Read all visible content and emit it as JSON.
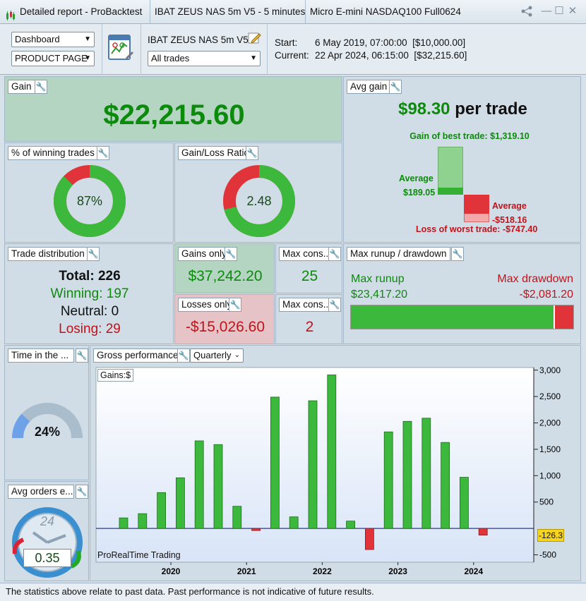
{
  "window": {
    "app_title": "Detailed report - ProBacktest",
    "strategy_title": "IBAT ZEUS NAS 5m V5 - 5 minutes",
    "instrument_title": "Micro E-mini NASDAQ100 Full0624"
  },
  "toolbar": {
    "view_select": "Dashboard",
    "page_select": "PRODUCT PAGE",
    "strategy_name": "IBAT ZEUS NAS 5m V5",
    "trades_filter": "All trades",
    "start_label": "Start:",
    "start_value": "6 May 2019, 07:00:00  [$10,000.00]",
    "current_label": "Current:",
    "current_value": "22 Apr 2024, 06:15:00  [$32,215.60]"
  },
  "gain": {
    "title": "Gain",
    "value": "$22,215.60"
  },
  "avg_gain": {
    "title": "Avg gain",
    "value": "$98.30",
    "suffix": "per trade",
    "best_label": "Gain of best trade: $1,319.10",
    "avg_win_label": "Average",
    "avg_win_value": "$189.05",
    "avg_loss_label": "Average",
    "avg_loss_value": "-$518.16",
    "worst_label": "Loss of worst trade: -$747.40",
    "best_trade": 1319.1,
    "avg_win": 189.05,
    "avg_loss": 518.16,
    "worst_trade": 747.4
  },
  "winning_pct": {
    "title": "% of winning trades",
    "label": "87%",
    "fraction": 0.87
  },
  "gain_loss": {
    "title": "Gain/Loss Ratio",
    "label": "2.48",
    "fraction": 0.71
  },
  "trade_dist": {
    "title": "Trade distribution",
    "total": "Total: 226",
    "winning": "Winning: 197",
    "neutral": "Neutral: 0",
    "losing": "Losing: 29"
  },
  "gains_only": {
    "title": "Gains only",
    "value": "$37,242.20"
  },
  "losses_only": {
    "title": "Losses only",
    "value": "-$15,026.60"
  },
  "max_cons_win": {
    "title": "Max cons...",
    "value": "25"
  },
  "max_cons_loss": {
    "title": "Max cons...",
    "value": "2"
  },
  "runup": {
    "title": "Max runup / drawdown",
    "runup_label": "Max runup",
    "runup_value": "$23,417.20",
    "drawdown_label": "Max drawdown",
    "drawdown_value": "-$2,081.20",
    "runup_fraction": 0.918
  },
  "time_in_market": {
    "title": "Time in the ...",
    "label": "24%",
    "fraction": 0.24
  },
  "avg_orders": {
    "title": "Avg orders e...",
    "value": "0.35",
    "clock_label": "24"
  },
  "gross": {
    "title": "Gross performance",
    "period": "Quarterly",
    "gains_tag": "Gains:",
    "unit": "$",
    "watermark": "ProRealTime Trading",
    "last_value": "-126.3"
  },
  "colors": {
    "green": "#0c8a0c",
    "red": "#c0141b",
    "bar_green": "#3cb83c",
    "bar_red": "#e0343a"
  },
  "chart_data": {
    "type": "bar",
    "ylim": [
      -500,
      3000
    ],
    "yticks": [
      3000,
      2500,
      2000,
      1500,
      1000,
      500,
      -500
    ],
    "ytick_labels": [
      "3,000",
      "2,500",
      "2,000",
      "1,500",
      "1,000",
      "500",
      "-500"
    ],
    "xtick_labels": [
      "2020",
      "2021",
      "2022",
      "2023",
      "2024"
    ],
    "xtick_index": [
      2.5,
      6.5,
      10.5,
      14.5,
      18.5
    ],
    "values": [
      200,
      280,
      680,
      960,
      1660,
      1590,
      420,
      -40,
      2490,
      220,
      2420,
      2910,
      140,
      -400,
      1830,
      2030,
      2090,
      1630,
      970,
      -126.3
    ]
  },
  "footer": "The statistics above relate to past data. Past performance is not indicative of future results."
}
